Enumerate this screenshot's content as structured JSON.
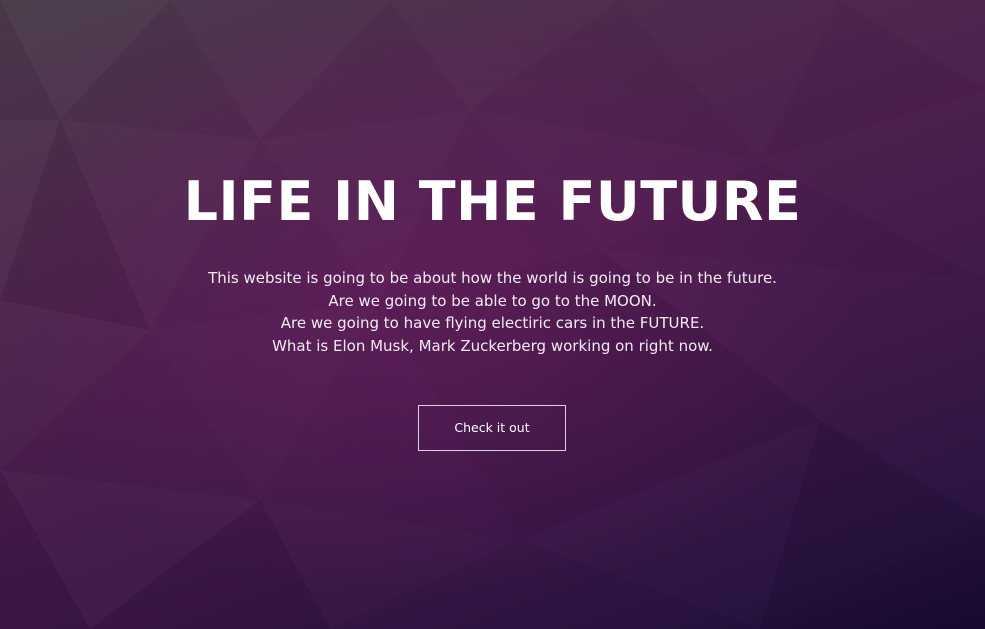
{
  "hero": {
    "title": "LIFE IN THE FUTURE",
    "description_lines": [
      "This website is going to be about how the world is going to be in the future.",
      "Are we going to be able to go to the MOON.",
      "Are we going to have flying electiric cars in the FUTURE.",
      "What is Elon Musk, Mark Zuckerberg working on right now."
    ],
    "cta_label": "Check it out"
  },
  "colors": {
    "text": "#ffffff",
    "background_top_left": "#473848",
    "background_mid": "#4a1d4b",
    "background_bottom_right": "#1a0b33"
  }
}
